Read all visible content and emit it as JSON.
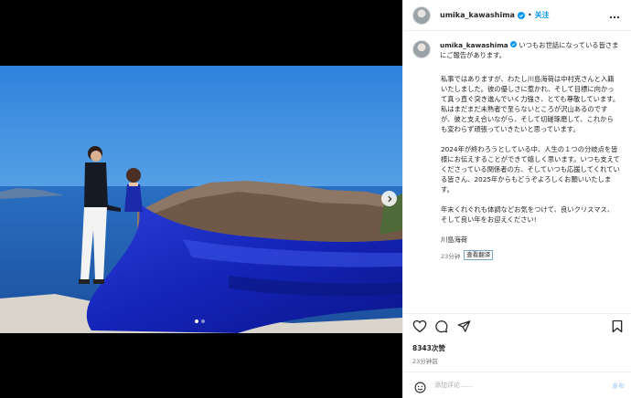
{
  "post": {
    "username": "umika_kawashima",
    "follow_label": "关注",
    "separator": "•",
    "caption_intro": "いつもお世話になっている皆さまにご報告があります。",
    "paragraph_1": "私事ではありますが、わたし川島海荷は中村克さんと入籍いたしました。彼の優しさに惹かれ、そして目標に向かって真っ直ぐ突き進んでいく力強さ、とても尊敬しています。\n私はまだまだ未熟者で至らないところが沢山あるのですが、彼と支え合いながら、そして切磋琢磨して、これからも変わらず頑張っていきたいと思っています。",
    "paragraph_2": "2024年が終わろうとしている中、人生の１つの分岐点を皆様にお伝えすることができて嬉しく思います。いつも支えてくださっている関係者の方、そしていつも応援してくれている皆さん、2025年からもどうぞよろしくお願いいたします。",
    "paragraph_3": "年末くれぐれも体調などお気をつけて、良いクリスマス、そして良い年をお迎えください!",
    "signature": "川島海荷",
    "caption_time": "23分钟",
    "translate_label": "查看翻译",
    "likes": "8343次赞",
    "posted_time": "23分钟前",
    "comment_placeholder": "添加评论……",
    "post_label": "发布"
  },
  "media": {
    "carousel_total": 2,
    "carousel_active": 1
  },
  "icons": {
    "verified": "verified-badge-icon",
    "more": "more-options-icon",
    "like": "heart-icon",
    "comment": "comment-icon",
    "share": "share-icon",
    "save": "bookmark-icon",
    "emoji": "emoji-icon",
    "next": "chevron-right-icon"
  },
  "colors": {
    "accent": "#0095f6",
    "dress": "#1420b0",
    "sky": "#56a0e4"
  }
}
